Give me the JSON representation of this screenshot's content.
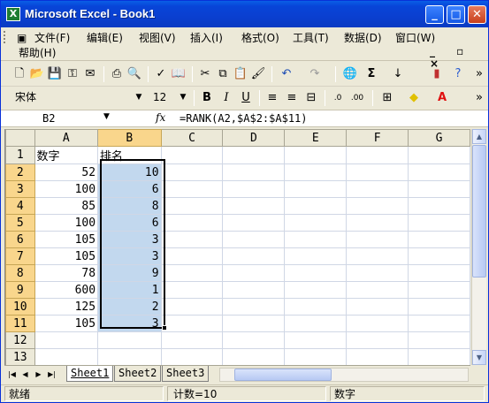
{
  "window": {
    "title": "Microsoft Excel - Book1",
    "app_icon": "X"
  },
  "menu": [
    "文件(F)",
    "编辑(E)",
    "视图(V)",
    "插入(I)",
    "格式(O)",
    "工具(T)",
    "数据(D)",
    "窗口(W)",
    "帮助(H)"
  ],
  "format": {
    "font": "宋体",
    "size": "12"
  },
  "formula_bar": {
    "name_box": "B2",
    "fx": "fx",
    "formula": "=RANK(A2,$A$2:$A$11)"
  },
  "columns": [
    "A",
    "B",
    "C",
    "D",
    "E",
    "F",
    "G"
  ],
  "rows": [
    {
      "n": "1",
      "a": "数字",
      "b": "排名"
    },
    {
      "n": "2",
      "a": "52",
      "b": "10"
    },
    {
      "n": "3",
      "a": "100",
      "b": "6"
    },
    {
      "n": "4",
      "a": "85",
      "b": "8"
    },
    {
      "n": "5",
      "a": "100",
      "b": "6"
    },
    {
      "n": "6",
      "a": "105",
      "b": "3"
    },
    {
      "n": "7",
      "a": "105",
      "b": "3"
    },
    {
      "n": "8",
      "a": "78",
      "b": "9"
    },
    {
      "n": "9",
      "a": "600",
      "b": "1"
    },
    {
      "n": "10",
      "a": "125",
      "b": "2"
    },
    {
      "n": "11",
      "a": "105",
      "b": "3"
    },
    {
      "n": "12",
      "a": "",
      "b": ""
    },
    {
      "n": "13",
      "a": "",
      "b": ""
    }
  ],
  "sheets": [
    "Sheet1",
    "Sheet2",
    "Sheet3"
  ],
  "status": {
    "ready": "就绪",
    "count": "计数=10",
    "mode": "数字"
  },
  "colors": {
    "title": "#0a46d8",
    "selection": "#c2d8ee",
    "header_selected": "#f9d68c"
  }
}
